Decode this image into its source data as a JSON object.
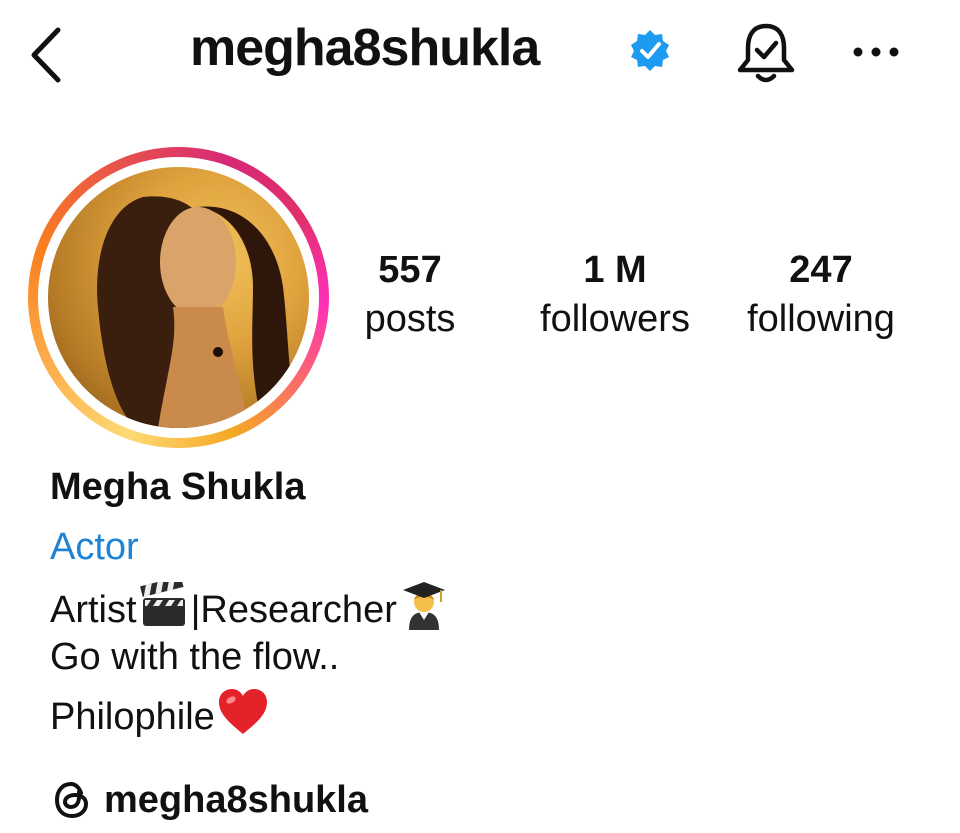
{
  "header": {
    "username": "megha8shukla",
    "back_icon": "chevron-left-icon",
    "verified_icon": "verified-badge-icon",
    "notification_icon": "bell-check-icon",
    "more_icon": "more-horizontal-icon"
  },
  "profile": {
    "avatar_ring_colors": [
      "#feda75",
      "#fa7e1e",
      "#d62976",
      "#ff2fb8"
    ],
    "stats": [
      {
        "value": "557",
        "label": "posts"
      },
      {
        "value": "1 M",
        "label": "followers"
      },
      {
        "value": "247",
        "label": "following"
      }
    ],
    "name": "Megha Shukla",
    "category": "Actor",
    "category_color": "#1f83d4",
    "bio": {
      "line1_a": "Artist",
      "line1_b": "|Researcher",
      "line2": "Go with the flow..",
      "line3": "Philophile"
    },
    "threads_handle": "megha8shukla",
    "threads_icon": "threads-icon"
  }
}
